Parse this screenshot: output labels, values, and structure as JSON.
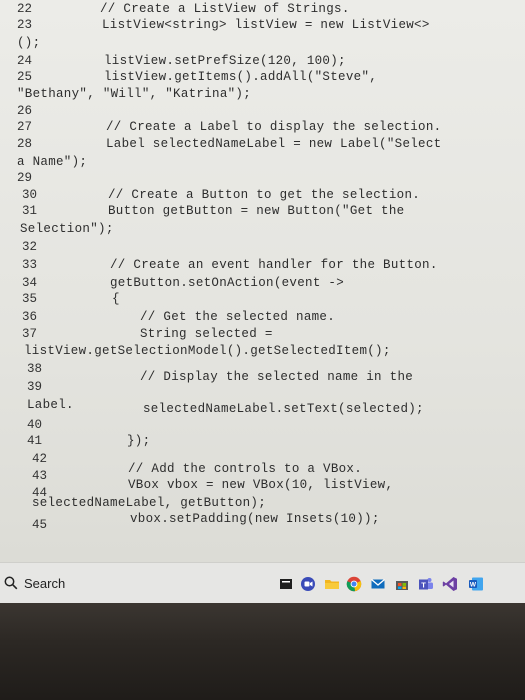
{
  "editor": {
    "lines": [
      {
        "num": "22",
        "code": "// Create a ListView of Strings."
      },
      {
        "num": "23",
        "code": "ListView<string> listView = new ListView<>"
      },
      {
        "num": "",
        "code": "();"
      },
      {
        "num": "24",
        "code": "listView.setPrefSize(120, 100);"
      },
      {
        "num": "25",
        "code": "listView.getItems().addAll(\"Steve\","
      },
      {
        "num": "",
        "code": "\"Bethany\", \"Will\", \"Katrina\");"
      },
      {
        "num": "26",
        "code": ""
      },
      {
        "num": "27",
        "code": "// Create a Label to display the selection."
      },
      {
        "num": "28",
        "code": "Label selectedNameLabel = new Label(\"Select"
      },
      {
        "num": "",
        "code": "a Name\");"
      },
      {
        "num": "29",
        "code": ""
      },
      {
        "num": "30",
        "code": "// Create a Button to get the selection."
      },
      {
        "num": "31",
        "code": "Button getButton = new Button(\"Get the"
      },
      {
        "num": "",
        "code": "Selection\");"
      },
      {
        "num": "32",
        "code": ""
      },
      {
        "num": "33",
        "code": "// Create an event handler for the Button."
      },
      {
        "num": "34",
        "code": "getButton.setOnAction(event ->"
      },
      {
        "num": "35",
        "code": "{"
      },
      {
        "num": "36",
        "code": "// Get the selected name."
      },
      {
        "num": "37",
        "code": "String selected ="
      },
      {
        "num": "",
        "code": "listView.getSelectionModel().getSelectedItem();"
      },
      {
        "num": "38",
        "code": ""
      },
      {
        "num": "39",
        "code": "// Display the selected name in the"
      },
      {
        "num": "",
        "code": "Label."
      },
      {
        "num": "40",
        "code": "selectedNameLabel.setText(selected);"
      },
      {
        "num": "41",
        "code": "});"
      },
      {
        "num": "42",
        "code": ""
      },
      {
        "num": "43",
        "code": "// Add the controls to a VBox."
      },
      {
        "num": "44",
        "code": "VBox vbox = new VBox(10, listView,"
      },
      {
        "num": "",
        "code": "selectedNameLabel, getButton);"
      },
      {
        "num": "45",
        "code": "vbox.setPadding(new Insets(10));"
      }
    ]
  },
  "taskbar": {
    "search_label": "Search",
    "icons": [
      "file-explorer-icon",
      "camera-chat-icon",
      "folder-icon",
      "chrome-icon",
      "mail-icon",
      "store-icon",
      "teams-icon",
      "visual-studio-icon",
      "word-icon"
    ]
  }
}
